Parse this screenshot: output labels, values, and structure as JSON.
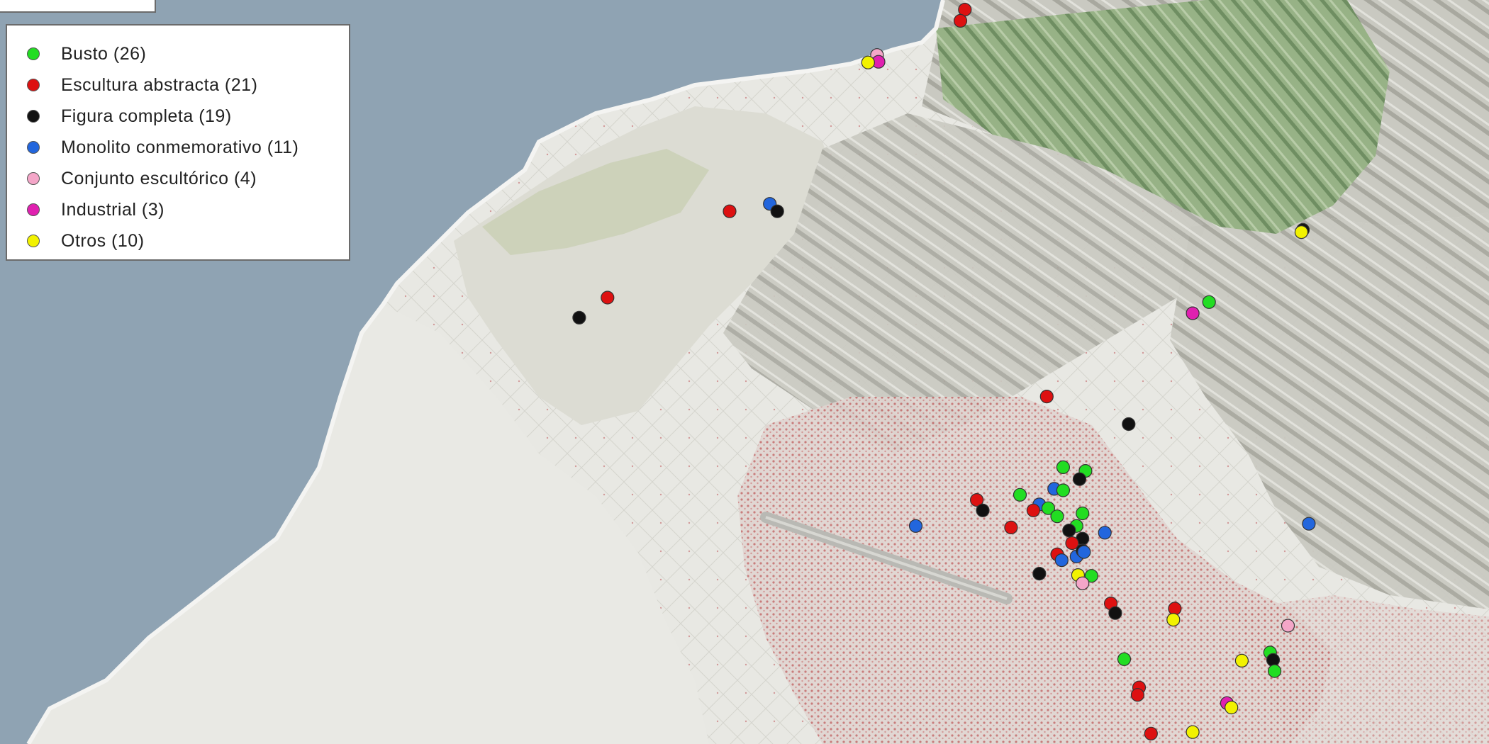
{
  "legend": {
    "items": [
      {
        "key": "busto",
        "label": "Busto (26)",
        "color": "#22dd22"
      },
      {
        "key": "abstracta",
        "label": "Escultura abstracta (21)",
        "color": "#dd1111"
      },
      {
        "key": "figura",
        "label": "Figura completa (19)",
        "color": "#111111"
      },
      {
        "key": "monolito",
        "label": "Monolito conmemorativo (11)",
        "color": "#2266dd"
      },
      {
        "key": "conjunto",
        "label": "Conjunto escultórico (4)",
        "color": "#f4a6c8"
      },
      {
        "key": "industrial",
        "label": "Industrial (3)",
        "color": "#e020b0"
      },
      {
        "key": "otros",
        "label": "Otros (10)",
        "color": "#f2f200"
      }
    ]
  },
  "map": {
    "colors": {
      "sea": "#8fa3b3",
      "land": "#e6e6e1",
      "urban": "#d9c8c4",
      "urban_dots": "#c46a6a",
      "mountains": "#bcbcb4",
      "forest": "#8fae7a"
    },
    "markers": [
      {
        "category": "abstracta",
        "lon": 0.648,
        "lat": 0.013
      },
      {
        "category": "abstracta",
        "lon": 0.645,
        "lat": 0.028
      },
      {
        "category": "conjunto",
        "lon": 0.589,
        "lat": 0.074
      },
      {
        "category": "industrial",
        "lon": 0.59,
        "lat": 0.083
      },
      {
        "category": "otros",
        "lon": 0.583,
        "lat": 0.084
      },
      {
        "category": "abstracta",
        "lon": 0.49,
        "lat": 0.284
      },
      {
        "category": "monolito",
        "lon": 0.517,
        "lat": 0.274
      },
      {
        "category": "figura",
        "lon": 0.522,
        "lat": 0.284
      },
      {
        "category": "abstracta",
        "lon": 0.408,
        "lat": 0.4
      },
      {
        "category": "figura",
        "lon": 0.389,
        "lat": 0.427
      },
      {
        "category": "figura",
        "lon": 0.875,
        "lat": 0.309
      },
      {
        "category": "otros",
        "lon": 0.874,
        "lat": 0.312
      },
      {
        "category": "busto",
        "lon": 0.812,
        "lat": 0.406
      },
      {
        "category": "industrial",
        "lon": 0.801,
        "lat": 0.421
      },
      {
        "category": "abstracta",
        "lon": 0.703,
        "lat": 0.533
      },
      {
        "category": "figura",
        "lon": 0.758,
        "lat": 0.57
      },
      {
        "category": "busto",
        "lon": 0.714,
        "lat": 0.628
      },
      {
        "category": "busto",
        "lon": 0.729,
        "lat": 0.633
      },
      {
        "category": "figura",
        "lon": 0.725,
        "lat": 0.644
      },
      {
        "category": "monolito",
        "lon": 0.708,
        "lat": 0.657
      },
      {
        "category": "busto",
        "lon": 0.714,
        "lat": 0.659
      },
      {
        "category": "busto",
        "lon": 0.685,
        "lat": 0.665
      },
      {
        "category": "abstracta",
        "lon": 0.656,
        "lat": 0.672
      },
      {
        "category": "figura",
        "lon": 0.66,
        "lat": 0.686
      },
      {
        "category": "monolito",
        "lon": 0.698,
        "lat": 0.678
      },
      {
        "category": "abstracta",
        "lon": 0.694,
        "lat": 0.686
      },
      {
        "category": "busto",
        "lon": 0.704,
        "lat": 0.683
      },
      {
        "category": "busto",
        "lon": 0.71,
        "lat": 0.694
      },
      {
        "category": "busto",
        "lon": 0.727,
        "lat": 0.69
      },
      {
        "category": "busto",
        "lon": 0.723,
        "lat": 0.707
      },
      {
        "category": "figura",
        "lon": 0.718,
        "lat": 0.713
      },
      {
        "category": "figura",
        "lon": 0.727,
        "lat": 0.724
      },
      {
        "category": "monolito",
        "lon": 0.742,
        "lat": 0.716
      },
      {
        "category": "abstracta",
        "lon": 0.72,
        "lat": 0.73
      },
      {
        "category": "abstracta",
        "lon": 0.71,
        "lat": 0.745
      },
      {
        "category": "monolito",
        "lon": 0.713,
        "lat": 0.753
      },
      {
        "category": "monolito",
        "lon": 0.723,
        "lat": 0.748
      },
      {
        "category": "figura",
        "lon": 0.727,
        "lat": 0.74
      },
      {
        "category": "monolito",
        "lon": 0.728,
        "lat": 0.742
      },
      {
        "category": "monolito",
        "lon": 0.615,
        "lat": 0.707
      },
      {
        "category": "abstracta",
        "lon": 0.679,
        "lat": 0.709
      },
      {
        "category": "figura",
        "lon": 0.698,
        "lat": 0.771
      },
      {
        "category": "otros",
        "lon": 0.724,
        "lat": 0.773
      },
      {
        "category": "busto",
        "lon": 0.733,
        "lat": 0.774
      },
      {
        "category": "conjunto",
        "lon": 0.727,
        "lat": 0.784
      },
      {
        "category": "monolito",
        "lon": 0.879,
        "lat": 0.704
      },
      {
        "category": "abstracta",
        "lon": 0.746,
        "lat": 0.811
      },
      {
        "category": "figura",
        "lon": 0.749,
        "lat": 0.824
      },
      {
        "category": "abstracta",
        "lon": 0.789,
        "lat": 0.818
      },
      {
        "category": "otros",
        "lon": 0.788,
        "lat": 0.833
      },
      {
        "category": "conjunto",
        "lon": 0.865,
        "lat": 0.841
      },
      {
        "category": "busto",
        "lon": 0.755,
        "lat": 0.886
      },
      {
        "category": "otros",
        "lon": 0.834,
        "lat": 0.888
      },
      {
        "category": "busto",
        "lon": 0.853,
        "lat": 0.877
      },
      {
        "category": "figura",
        "lon": 0.855,
        "lat": 0.887
      },
      {
        "category": "busto",
        "lon": 0.856,
        "lat": 0.902
      },
      {
        "category": "abstracta",
        "lon": 0.765,
        "lat": 0.924
      },
      {
        "category": "abstracta",
        "lon": 0.764,
        "lat": 0.934
      },
      {
        "category": "industrial",
        "lon": 0.824,
        "lat": 0.945
      },
      {
        "category": "otros",
        "lon": 0.827,
        "lat": 0.951
      },
      {
        "category": "abstracta",
        "lon": 0.773,
        "lat": 0.986
      },
      {
        "category": "otros",
        "lon": 0.801,
        "lat": 0.984
      }
    ]
  }
}
